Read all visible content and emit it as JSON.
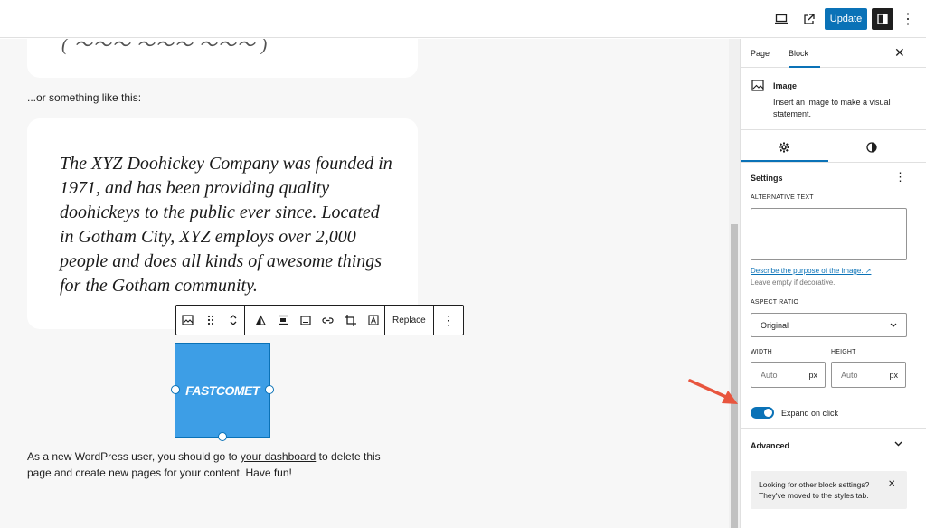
{
  "topbar": {
    "update_label": "Update",
    "more_glyph": "⋮",
    "icons": [
      "desktop-preview-icon",
      "external-view-icon",
      "sidebar-toggle-icon",
      "more-options-icon"
    ]
  },
  "canvas": {
    "intro_text": "...or something like this:",
    "cut_text": "( 〜〜〜 〜〜〜 〜〜〜 )",
    "quote_text": "The XYZ Doohickey Company was founded in 1971, and has been providing quality doohickeys to the public ever since. Located in Gotham City, XYZ employs over 2,000 people and does all kinds of awesome things for the Gotham community.",
    "image_logo_text": "FASTCOMET",
    "paragraph_before": "As a new WordPress user, you should go to ",
    "paragraph_link": "your dashboard",
    "paragraph_after": " to delete this page and create new pages for your content. Have fun!"
  },
  "block_toolbar": {
    "replace_label": "Replace",
    "more_glyph": "⋮"
  },
  "sidebar": {
    "tabs": [
      {
        "label": "Page",
        "active": false
      },
      {
        "label": "Block",
        "active": true
      }
    ],
    "close_glyph": "✕",
    "block_title": "Image",
    "block_description": "Insert an image to make a visual statement.",
    "settings_heading": "Settings",
    "settings_more_glyph": "⋮",
    "alt_text_label": "ALTERNATIVE TEXT",
    "alt_text_value": "",
    "describe_link": "Describe the purpose of the image.",
    "describe_link_icon": "↗",
    "describe_help": "Leave empty if decorative.",
    "aspect_ratio_label": "ASPECT RATIO",
    "aspect_ratio_value": "Original",
    "width_label": "WIDTH",
    "height_label": "HEIGHT",
    "width_placeholder": "Auto",
    "height_placeholder": "Auto",
    "unit": "px",
    "expand_on_click_label": "Expand on click",
    "expand_on_click_enabled": true,
    "advanced_label": "Advanced",
    "notice_text": "Looking for other block settings? They've moved to the styles tab.",
    "notice_close_glyph": "✕"
  },
  "colors": {
    "accent": "#0a72b7",
    "image_bg": "#3d9ee6",
    "arrow": "#e8553e"
  }
}
